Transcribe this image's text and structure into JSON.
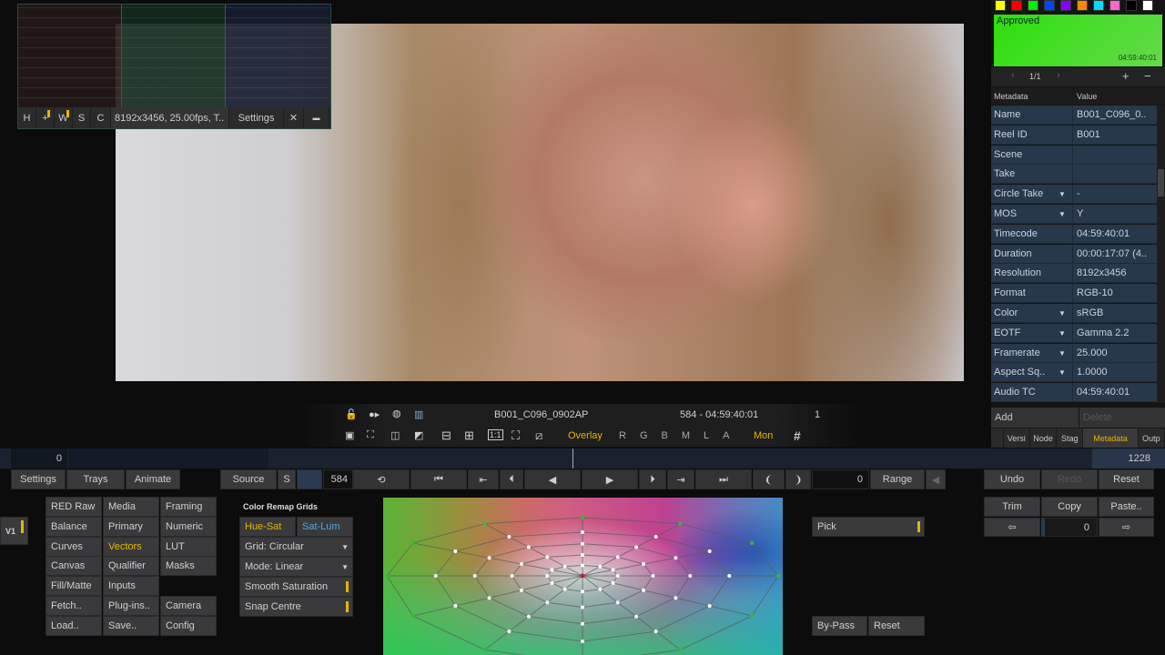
{
  "scopes": {
    "buttons": [
      "H",
      "+",
      "W",
      "S",
      "C"
    ],
    "info": "8192x3456, 25.00fps, T..",
    "settings": "Settings",
    "close": "✕",
    "minimize": "▬"
  },
  "right": {
    "swatches": [
      "#ffff00",
      "#ff0000",
      "#00ee00",
      "#0044ff",
      "#8800ff",
      "#ff8800",
      "#00ddff",
      "#ff66cc",
      "#000000",
      "#ffffff"
    ],
    "approval": {
      "label": "Approved",
      "timecode": "04:59:40:01",
      "color": "#33e01a"
    },
    "nav": {
      "page": "1/1",
      "prev": "‹",
      "next": "›",
      "add": "+",
      "remove": "−"
    },
    "header": {
      "key": "Metadata",
      "value": "Value"
    },
    "rows": [
      {
        "k": "Name",
        "v": "B001_C096_0..",
        "dd": false
      },
      {
        "k": "Reel ID",
        "v": "B001",
        "dd": false
      },
      {
        "k": "Scene",
        "v": "",
        "dd": false
      },
      {
        "k": "Take",
        "v": "",
        "dd": false
      },
      {
        "k": "Circle Take",
        "v": "-",
        "dd": true
      },
      {
        "k": "MOS",
        "v": "Y",
        "dd": true
      },
      {
        "k": "Timecode",
        "v": "04:59:40:01",
        "dd": false
      },
      {
        "k": "Duration",
        "v": "00:00:17:07 (4..",
        "dd": false
      },
      {
        "k": "Resolution",
        "v": "8192x3456",
        "dd": false
      },
      {
        "k": "Format",
        "v": "RGB-10",
        "dd": false
      },
      {
        "k": "Color",
        "v": "sRGB",
        "dd": true
      },
      {
        "k": "EOTF",
        "v": "Gamma 2.2",
        "dd": true
      },
      {
        "k": "Framerate",
        "v": "25.000",
        "dd": true
      },
      {
        "k": "Aspect Sq..",
        "v": "1.0000",
        "dd": true
      },
      {
        "k": "Audio TC",
        "v": "04:59:40:01",
        "dd": false
      }
    ],
    "add": "Add",
    "delete": "Delete",
    "tabs": [
      "Versi",
      "Node",
      "Stag",
      "Metadata",
      "Outp"
    ],
    "active_tab": "Metadata"
  },
  "transport": {
    "clip": "B001_C096_0902AP",
    "frame_tc": "584  -  04:59:40:01",
    "count": "1",
    "overlay": "Overlay",
    "channels": [
      "R",
      "G",
      "B",
      "M",
      "L",
      "A"
    ],
    "mon": "Mon",
    "grid": "#"
  },
  "timeline": {
    "start": "0",
    "end": "1228",
    "position_fraction": 0.4756
  },
  "toolbar": {
    "settings": "Settings",
    "trays": "Trays",
    "animate": "Animate",
    "source": "Source",
    "s": "S",
    "frame": "584",
    "range_value": "0",
    "range": "Range",
    "undo": "Undo",
    "redo": "Redo",
    "reset": "Reset"
  },
  "layers": {
    "v1": "V1"
  },
  "ops": [
    "RED Raw",
    "Media",
    "Framing",
    "Balance",
    "Primary",
    "Numeric",
    "Curves",
    "Vectors",
    "LUT",
    "Canvas",
    "Qualifier",
    "Masks",
    "Fill/Matte",
    "Inputs",
    "",
    "Fetch..",
    "Plug-ins..",
    "Camera",
    "Load..",
    "Save..",
    "Config"
  ],
  "active_op": "Vectors",
  "remap": {
    "title": "Color Remap Grids",
    "hue_sat": "Hue-Sat",
    "sat_lum": "Sat-Lum",
    "grid": "Grid: Circular",
    "mode": "Mode: Linear",
    "smooth": "Smooth Saturation",
    "snap": "Snap Centre"
  },
  "pick": "Pick",
  "bypass": "By-Pass",
  "reset2": "Reset",
  "trim": {
    "trim": "Trim",
    "copy": "Copy",
    "paste": "Paste..",
    "value": "0",
    "left": "⇦",
    "right": "⇨"
  },
  "accent": "#e8b400"
}
